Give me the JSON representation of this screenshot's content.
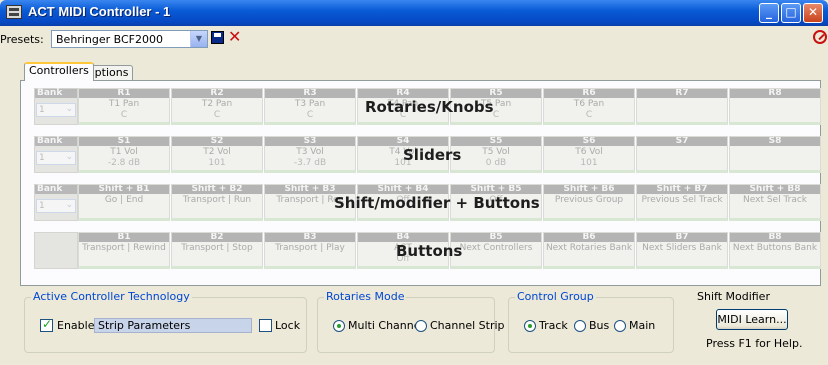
{
  "window": {
    "title": "ACT MIDI Controller - 1"
  },
  "presets": {
    "label": "Presets:",
    "value": "Behringer BCF2000"
  },
  "tabs": [
    {
      "label": "Controllers"
    },
    {
      "label": "Options"
    }
  ],
  "bank_label": "Bank",
  "bank_value": "1",
  "rows": [
    {
      "overlay": "Rotaries/Knobs",
      "cells": [
        {
          "header": "R1",
          "label": "T1 Pan",
          "value": "C"
        },
        {
          "header": "R2",
          "label": "T2 Pan",
          "value": "C"
        },
        {
          "header": "R3",
          "label": "T3 Pan",
          "value": "C"
        },
        {
          "header": "R4",
          "label": "T4 Pan",
          "value": "C"
        },
        {
          "header": "R5",
          "label": "T5 Pan",
          "value": "C"
        },
        {
          "header": "R6",
          "label": "T6 Pan",
          "value": "C"
        },
        {
          "header": "R7",
          "label": "",
          "value": ""
        },
        {
          "header": "R8",
          "label": "",
          "value": ""
        }
      ]
    },
    {
      "overlay": "Sliders",
      "cells": [
        {
          "header": "S1",
          "label": "T1 Vol",
          "value": "-2.8 dB"
        },
        {
          "header": "S2",
          "label": "T2 Vol",
          "value": "101"
        },
        {
          "header": "S3",
          "label": "T3 Vol",
          "value": "-3.7 dB"
        },
        {
          "header": "S4",
          "label": "T4 Vol",
          "value": "101"
        },
        {
          "header": "S5",
          "label": "T5 Vol",
          "value": "0 dB"
        },
        {
          "header": "S6",
          "label": "T6 Vol",
          "value": "101"
        },
        {
          "header": "S7",
          "label": "",
          "value": ""
        },
        {
          "header": "S8",
          "label": "",
          "value": ""
        }
      ]
    },
    {
      "overlay": "Shift/modifier + Buttons",
      "cells": [
        {
          "header": "Shift + B1",
          "label": "Go | End",
          "value": ""
        },
        {
          "header": "Shift + B2",
          "label": "Transport | Run",
          "value": ""
        },
        {
          "header": "Shift + B3",
          "label": "Transport | Rec",
          "value": ""
        },
        {
          "header": "Shift + B4",
          "label": "",
          "value": "Off"
        },
        {
          "header": "Shift + B5",
          "label": "",
          "value": "Off"
        },
        {
          "header": "Shift + B6",
          "label": "Previous Group",
          "value": ""
        },
        {
          "header": "Shift + B7",
          "label": "Previous Sel Track",
          "value": ""
        },
        {
          "header": "Shift + B8",
          "label": "Next Sel Track",
          "value": ""
        }
      ]
    },
    {
      "overlay": "Buttons",
      "cells": [
        {
          "header": "B1",
          "label": "Transport | Rewind",
          "value": ""
        },
        {
          "header": "B2",
          "label": "Transport | Stop",
          "value": ""
        },
        {
          "header": "B3",
          "label": "Transport | Play",
          "value": ""
        },
        {
          "header": "B4",
          "label": "ACT",
          "value": "Off"
        },
        {
          "header": "B5",
          "label": "Next Controllers",
          "value": ""
        },
        {
          "header": "B6",
          "label": "Next Rotaries Bank",
          "value": ""
        },
        {
          "header": "B7",
          "label": "Next Sliders Bank",
          "value": ""
        },
        {
          "header": "B8",
          "label": "Next Buttons Bank",
          "value": ""
        }
      ]
    }
  ],
  "act": {
    "title": "Active Controller Technology",
    "enable_label": "Enable",
    "enable_checked": true,
    "field_value": "Strip Parameters",
    "lock_label": "Lock",
    "lock_checked": false
  },
  "rotaries_mode": {
    "title": "Rotaries Mode",
    "options": [
      {
        "label": "Multi Channel",
        "selected": true
      },
      {
        "label": "Channel Strip",
        "selected": false
      }
    ]
  },
  "control_group": {
    "title": "Control Group",
    "options": [
      {
        "label": "Track",
        "selected": true
      },
      {
        "label": "Bus",
        "selected": false
      },
      {
        "label": "Main",
        "selected": false
      }
    ]
  },
  "shift_modifier": {
    "title": "Shift Modifier",
    "button_label": "MIDI Learn..."
  },
  "help_text": "Press F1 for Help."
}
